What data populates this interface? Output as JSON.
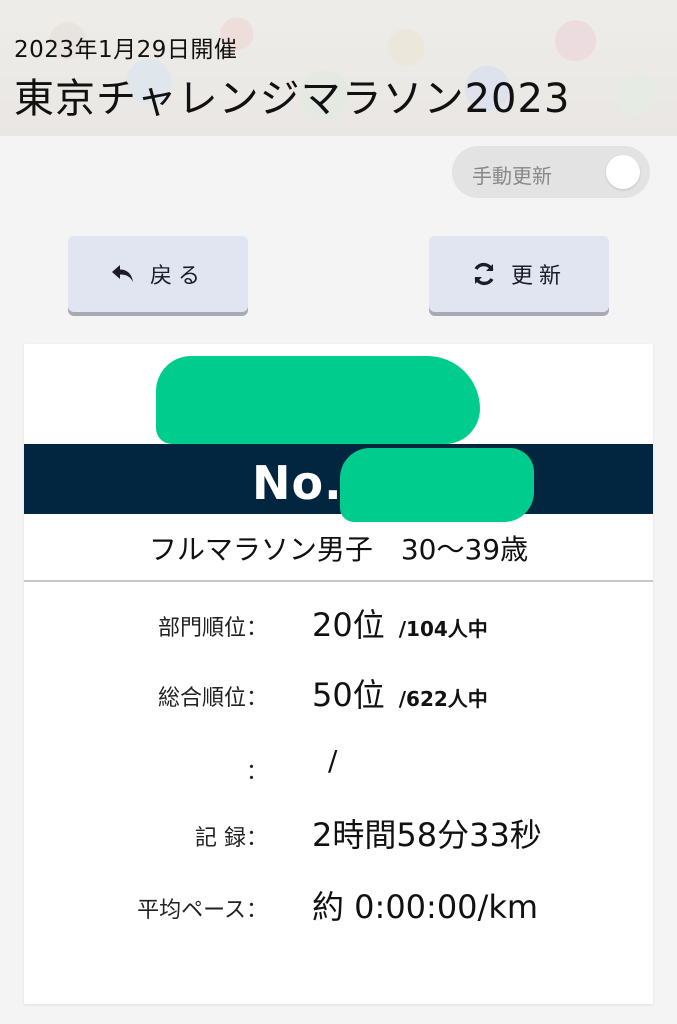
{
  "header": {
    "date": "2023年1月29日開催",
    "title": "東京チャレンジマラソン2023"
  },
  "toggle": {
    "label": "手動更新",
    "state": "off"
  },
  "buttons": {
    "back": "戻る",
    "refresh": "更新"
  },
  "result": {
    "number_prefix": "No.",
    "category": "フルマラソン男子　30〜39歳",
    "rows": [
      {
        "label": "部門順位：",
        "value": "20位",
        "sub": "/104人中"
      },
      {
        "label": "総合順位：",
        "value": "50位",
        "sub": "/622人中"
      },
      {
        "label": "：",
        "value": "/",
        "sub": ""
      },
      {
        "label": "記 録：",
        "value": "2時間58分33秒",
        "sub": ""
      },
      {
        "label": "平均ペース：",
        "value": "約 0:00:00/km",
        "sub": ""
      }
    ]
  },
  "colors": {
    "number_bar": "#02263f",
    "redaction": "#00cc8e",
    "button_bg": "#e1e4f1"
  }
}
